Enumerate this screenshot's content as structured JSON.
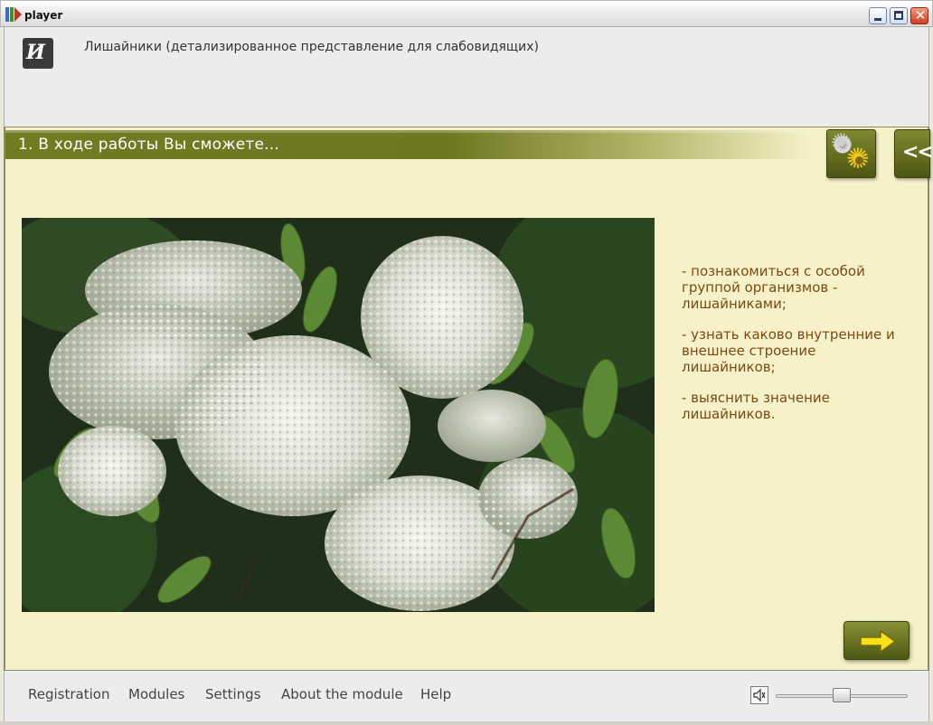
{
  "window": {
    "title": "player"
  },
  "header": {
    "logo_text": "И",
    "title": "Лишайники (детализированное представление для слабовидящих)"
  },
  "section": {
    "title": "1. В ходе работы Вы сможете...",
    "collapse_label": "<<"
  },
  "content": {
    "bullets": [
      "- познакомиться с особой группой организмов - лишайниками;",
      "- узнать каково внутренние и внешнее строение лишайников;",
      "- выяснить значение лишайников."
    ]
  },
  "bottom_menu": {
    "items": [
      "Registration",
      "Modules",
      "Settings",
      "About the module",
      "Help"
    ]
  },
  "volume": {
    "level": 0.5
  },
  "colors": {
    "accent_olive": "#727a22",
    "content_bg": "#f6f1c8",
    "bullet_text": "#7a4a12"
  }
}
